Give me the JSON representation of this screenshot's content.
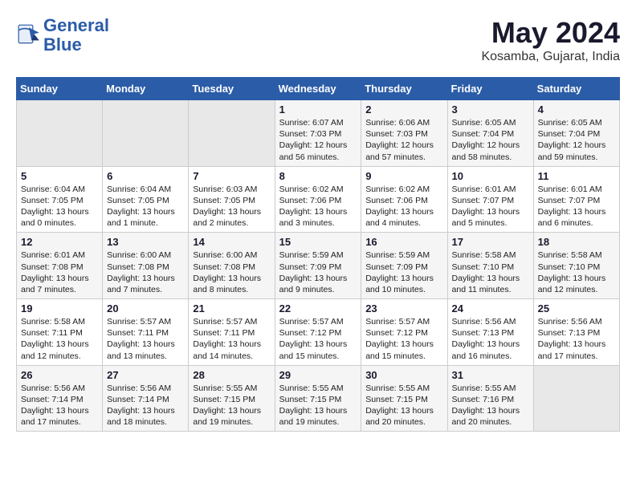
{
  "header": {
    "logo_line1": "General",
    "logo_line2": "Blue",
    "month": "May 2024",
    "location": "Kosamba, Gujarat, India"
  },
  "columns": [
    "Sunday",
    "Monday",
    "Tuesday",
    "Wednesday",
    "Thursday",
    "Friday",
    "Saturday"
  ],
  "weeks": [
    [
      {
        "day": "",
        "text": ""
      },
      {
        "day": "",
        "text": ""
      },
      {
        "day": "",
        "text": ""
      },
      {
        "day": "1",
        "text": "Sunrise: 6:07 AM\nSunset: 7:03 PM\nDaylight: 12 hours and 56 minutes."
      },
      {
        "day": "2",
        "text": "Sunrise: 6:06 AM\nSunset: 7:03 PM\nDaylight: 12 hours and 57 minutes."
      },
      {
        "day": "3",
        "text": "Sunrise: 6:05 AM\nSunset: 7:04 PM\nDaylight: 12 hours and 58 minutes."
      },
      {
        "day": "4",
        "text": "Sunrise: 6:05 AM\nSunset: 7:04 PM\nDaylight: 12 hours and 59 minutes."
      }
    ],
    [
      {
        "day": "5",
        "text": "Sunrise: 6:04 AM\nSunset: 7:05 PM\nDaylight: 13 hours and 0 minutes."
      },
      {
        "day": "6",
        "text": "Sunrise: 6:04 AM\nSunset: 7:05 PM\nDaylight: 13 hours and 1 minute."
      },
      {
        "day": "7",
        "text": "Sunrise: 6:03 AM\nSunset: 7:05 PM\nDaylight: 13 hours and 2 minutes."
      },
      {
        "day": "8",
        "text": "Sunrise: 6:02 AM\nSunset: 7:06 PM\nDaylight: 13 hours and 3 minutes."
      },
      {
        "day": "9",
        "text": "Sunrise: 6:02 AM\nSunset: 7:06 PM\nDaylight: 13 hours and 4 minutes."
      },
      {
        "day": "10",
        "text": "Sunrise: 6:01 AM\nSunset: 7:07 PM\nDaylight: 13 hours and 5 minutes."
      },
      {
        "day": "11",
        "text": "Sunrise: 6:01 AM\nSunset: 7:07 PM\nDaylight: 13 hours and 6 minutes."
      }
    ],
    [
      {
        "day": "12",
        "text": "Sunrise: 6:01 AM\nSunset: 7:08 PM\nDaylight: 13 hours and 7 minutes."
      },
      {
        "day": "13",
        "text": "Sunrise: 6:00 AM\nSunset: 7:08 PM\nDaylight: 13 hours and 7 minutes."
      },
      {
        "day": "14",
        "text": "Sunrise: 6:00 AM\nSunset: 7:08 PM\nDaylight: 13 hours and 8 minutes."
      },
      {
        "day": "15",
        "text": "Sunrise: 5:59 AM\nSunset: 7:09 PM\nDaylight: 13 hours and 9 minutes."
      },
      {
        "day": "16",
        "text": "Sunrise: 5:59 AM\nSunset: 7:09 PM\nDaylight: 13 hours and 10 minutes."
      },
      {
        "day": "17",
        "text": "Sunrise: 5:58 AM\nSunset: 7:10 PM\nDaylight: 13 hours and 11 minutes."
      },
      {
        "day": "18",
        "text": "Sunrise: 5:58 AM\nSunset: 7:10 PM\nDaylight: 13 hours and 12 minutes."
      }
    ],
    [
      {
        "day": "19",
        "text": "Sunrise: 5:58 AM\nSunset: 7:11 PM\nDaylight: 13 hours and 12 minutes."
      },
      {
        "day": "20",
        "text": "Sunrise: 5:57 AM\nSunset: 7:11 PM\nDaylight: 13 hours and 13 minutes."
      },
      {
        "day": "21",
        "text": "Sunrise: 5:57 AM\nSunset: 7:11 PM\nDaylight: 13 hours and 14 minutes."
      },
      {
        "day": "22",
        "text": "Sunrise: 5:57 AM\nSunset: 7:12 PM\nDaylight: 13 hours and 15 minutes."
      },
      {
        "day": "23",
        "text": "Sunrise: 5:57 AM\nSunset: 7:12 PM\nDaylight: 13 hours and 15 minutes."
      },
      {
        "day": "24",
        "text": "Sunrise: 5:56 AM\nSunset: 7:13 PM\nDaylight: 13 hours and 16 minutes."
      },
      {
        "day": "25",
        "text": "Sunrise: 5:56 AM\nSunset: 7:13 PM\nDaylight: 13 hours and 17 minutes."
      }
    ],
    [
      {
        "day": "26",
        "text": "Sunrise: 5:56 AM\nSunset: 7:14 PM\nDaylight: 13 hours and 17 minutes."
      },
      {
        "day": "27",
        "text": "Sunrise: 5:56 AM\nSunset: 7:14 PM\nDaylight: 13 hours and 18 minutes."
      },
      {
        "day": "28",
        "text": "Sunrise: 5:55 AM\nSunset: 7:15 PM\nDaylight: 13 hours and 19 minutes."
      },
      {
        "day": "29",
        "text": "Sunrise: 5:55 AM\nSunset: 7:15 PM\nDaylight: 13 hours and 19 minutes."
      },
      {
        "day": "30",
        "text": "Sunrise: 5:55 AM\nSunset: 7:15 PM\nDaylight: 13 hours and 20 minutes."
      },
      {
        "day": "31",
        "text": "Sunrise: 5:55 AM\nSunset: 7:16 PM\nDaylight: 13 hours and 20 minutes."
      },
      {
        "day": "",
        "text": ""
      }
    ]
  ]
}
